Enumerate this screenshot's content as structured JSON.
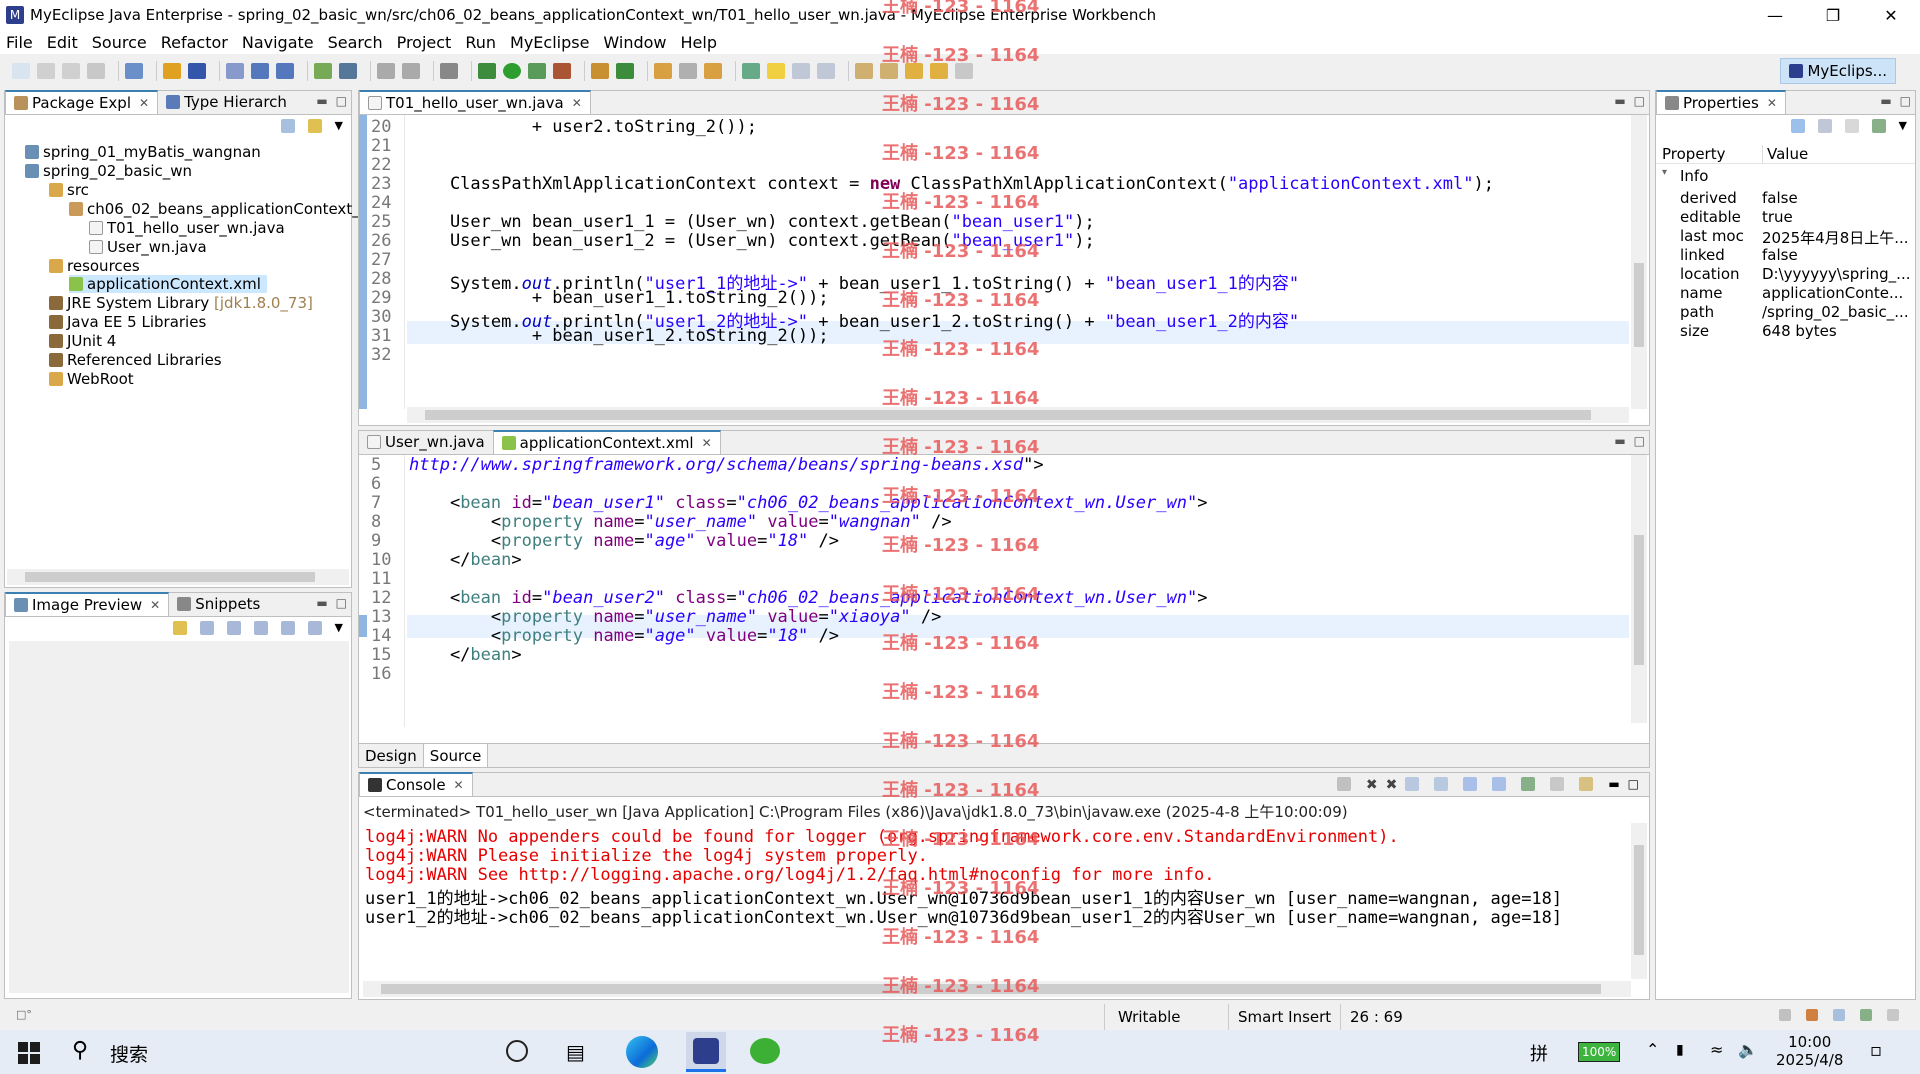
{
  "window": {
    "title": "MyEclipse Java Enterprise - spring_02_basic_wn/src/ch06_02_beans_applicationContext_wn/T01_hello_user_wn.java - MyEclipse Enterprise Workbench"
  },
  "menu": [
    "File",
    "Edit",
    "Source",
    "Refactor",
    "Navigate",
    "Search",
    "Project",
    "Run",
    "MyEclipse",
    "Window",
    "Help"
  ],
  "perspective": "MyEclips...",
  "package_explorer": {
    "tabs": [
      "Package Expl",
      "Type Hierarch"
    ],
    "items": [
      {
        "label": "spring_01_myBatis_wangnan"
      },
      {
        "label": "spring_02_basic_wn"
      },
      {
        "label": "src"
      },
      {
        "label": "ch06_02_beans_applicationContext_"
      },
      {
        "label": "T01_hello_user_wn.java"
      },
      {
        "label": "User_wn.java"
      },
      {
        "label": "resources"
      },
      {
        "label": "applicationContext.xml"
      },
      {
        "label": "JRE System Library",
        "suffix": "[jdk1.8.0_73]"
      },
      {
        "label": "Java EE 5 Libraries"
      },
      {
        "label": "JUnit 4"
      },
      {
        "label": "Referenced Libraries"
      },
      {
        "label": "WebRoot"
      }
    ]
  },
  "image_preview": {
    "tabs": [
      "Image Preview",
      "Snippets"
    ]
  },
  "java_editor": {
    "tab": "T01_hello_user_wn.java",
    "line_numbers": [
      "20",
      "21",
      "22",
      "23",
      "24",
      "25",
      "26",
      "27",
      "28",
      "29",
      "30",
      "31",
      "32"
    ],
    "lines": [
      "            + user2.toString_2());",
      "",
      "",
      "    ClassPathXmlApplicationContext context = new ClassPathXmlApplicationContext(\"applicationContext.xml\");",
      "",
      "    User_wn bean_user1_1 = (User_wn) context.getBean(\"bean_user1\");",
      "    User_wn bean_user1_2 = (User_wn) context.getBean(\"bean_user1\");",
      "",
      "    System.out.println(\"user1_1的地址->\" + bean_user1_1.toString() + \"bean_user1_1的内容\"",
      "            + bean_user1_1.toString_2());",
      "    System.out.println(\"user1_2的地址->\" + bean_user1_2.toString() + \"bean_user1_2的内容\"",
      "            + bean_user1_2.toString_2());",
      ""
    ]
  },
  "xml_editor": {
    "tabs": [
      "User_wn.java",
      "applicationContext.xml"
    ],
    "line_numbers": [
      "5",
      "6",
      "7",
      "8",
      "9",
      "10",
      "11",
      "12",
      "13",
      "14",
      "15",
      "16"
    ],
    "lines": [
      "http://www.springframework.org/schema/beans/spring-beans.xsd\">",
      "",
      "    <bean id=\"bean_user1\" class=\"ch06_02_beans_applicationContext_wn.User_wn\">",
      "        <property name=\"user_name\" value=\"wangnan\" />",
      "        <property name=\"age\" value=\"18\" />",
      "    </bean>",
      "",
      "    <bean id=\"bean_user2\" class=\"ch06_02_beans_applicationContext_wn.User_wn\">",
      "        <property name=\"user_name\" value=\"xiaoya\" />",
      "        <property name=\"age\" value=\"18\" />",
      "    </bean>",
      ""
    ],
    "bottom_tabs": [
      "Design",
      "Source"
    ]
  },
  "console": {
    "tab": "Console",
    "header": "<terminated> T01_hello_user_wn [Java Application] C:\\Program Files (x86)\\Java\\jdk1.8.0_73\\bin\\javaw.exe (2025-4-8 上午10:00:09)",
    "lines": [
      {
        "text": "log4j:WARN No appenders could be found for logger (org.springframework.core.env.StandardEnvironment).",
        "color": "#e60000"
      },
      {
        "text": "log4j:WARN Please initialize the log4j system properly.",
        "color": "#e60000"
      },
      {
        "text": "log4j:WARN See http://logging.apache.org/log4j/1.2/faq.html#noconfig for more info.",
        "color": "#e60000"
      },
      {
        "text": "user1_1的地址->ch06_02_beans_applicationContext_wn.User_wn@10736d9bean_user1_1的内容User_wn [user_name=wangnan, age=18]",
        "color": "#000000"
      },
      {
        "text": "user1_2的地址->ch06_02_beans_applicationContext_wn.User_wn@10736d9bean_user1_2的内容User_wn [user_name=wangnan, age=18]",
        "color": "#000000"
      }
    ]
  },
  "properties": {
    "tab": "Properties",
    "col_property": "Property",
    "col_value": "Value",
    "group": "Info",
    "rows": [
      {
        "k": "derived",
        "v": "false"
      },
      {
        "k": "editable",
        "v": "true"
      },
      {
        "k": "last moc",
        "v": "2025年4月8日上午..."
      },
      {
        "k": "linked",
        "v": "false"
      },
      {
        "k": "location",
        "v": "D:\\yyyyyy\\spring_..."
      },
      {
        "k": "name",
        "v": "applicationConte..."
      },
      {
        "k": "path",
        "v": "/spring_02_basic_..."
      },
      {
        "k": "size",
        "v": "648  bytes"
      }
    ]
  },
  "status": {
    "writable": "Writable",
    "insert": "Smart Insert",
    "pos": "26 : 69"
  },
  "taskbar": {
    "search": "搜索",
    "time": "10:00",
    "date": "2025/4/8",
    "battery": "100%"
  },
  "watermark": "王楠 -123 - 1164"
}
